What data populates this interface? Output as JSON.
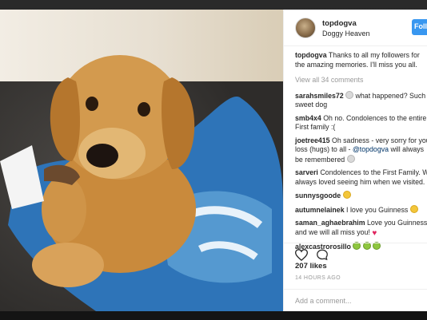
{
  "post": {
    "username": "topdogva",
    "location": "Doggy Heaven",
    "follow_label": "Follo",
    "caption_user": "topdogva",
    "caption_text": " Thanks to all my followers for",
    "caption_text2": "the amazing memories. I'll miss you all.",
    "view_all": "View all 34 comments",
    "likes": "207 likes",
    "time": "14 HOURS AGO",
    "add_comment_placeholder": "Add a comment..."
  },
  "comments": [
    {
      "user": "sarahsmiles72",
      "line1": " what happened? Such",
      "line2": "sweet dog"
    },
    {
      "user": "smb4x4",
      "line1": " Oh no. Condolences to the entire",
      "line2": "First family :("
    },
    {
      "user": "joetree415",
      "line1": " Oh sadness - very sorry for you",
      "line2": "loss (hugs) to all - ",
      "mention": "@topdogva",
      "line2b": " will always",
      "line3": "be remembered"
    },
    {
      "user": "sarveri",
      "line1": " Condolences to the First Family. W",
      "line2": "always loved seeing him when we visited."
    },
    {
      "user": "sunnysgoode"
    },
    {
      "user": "autumnelainek",
      "line1": " I love you Guinness"
    },
    {
      "user": "saman_aghaebrahim",
      "line1": " Love you Guinness",
      "line2": "and we will all miss you!"
    },
    {
      "user": "alexcastrorosillo"
    }
  ],
  "icons": {
    "heart": "heart-icon",
    "comment": "comment-icon"
  },
  "colors": {
    "follow_button": "#3897f0",
    "username": "#262626",
    "muted": "#999999",
    "mention": "#003569"
  }
}
